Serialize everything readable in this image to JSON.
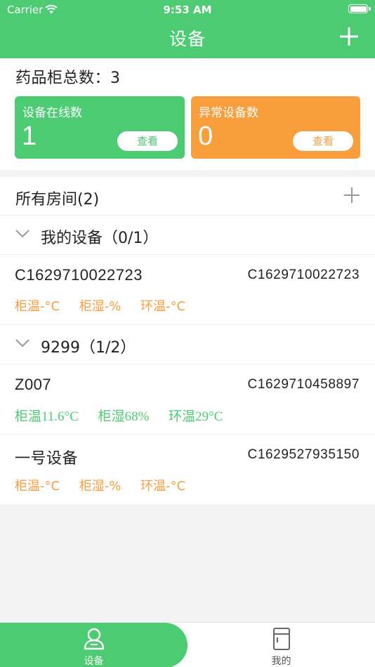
{
  "status_bar": {
    "carrier": "Carrier",
    "time": "9:53 AM"
  },
  "nav": {
    "title": "设备",
    "add_icon": "plus-icon"
  },
  "summary": {
    "total_label": "药品柜总数：3",
    "online": {
      "label": "设备在线数",
      "value": "1",
      "button": "查看",
      "color": "#4ccb72"
    },
    "abnormal": {
      "label": "异常设备数",
      "value": "0",
      "button": "查看",
      "color": "#f89e3c"
    }
  },
  "rooms": {
    "title": "所有房间(2)",
    "groups": [
      {
        "label": "我的设备（0/1）",
        "devices": [
          {
            "name": "C1629710022723",
            "id": "C1629710022723",
            "metrics": [
              "柜温-°C",
              "柜湿-%",
              "环温-°C"
            ],
            "status": "offline"
          }
        ]
      },
      {
        "label": "9299（1/2）",
        "devices": [
          {
            "name": "Z007",
            "id": "C1629710458897",
            "metrics": [
              "柜温11.6°C",
              "柜湿68%",
              "环温29°C"
            ],
            "status": "online"
          },
          {
            "name": "一号设备",
            "id": "C1629527935150",
            "metrics": [
              "柜温-°C",
              "柜湿-%",
              "环温-°C"
            ],
            "status": "offline"
          }
        ]
      }
    ]
  },
  "tabbar": {
    "tabs": [
      {
        "label": "设备",
        "icon": "person-icon",
        "active": true
      },
      {
        "label": "我的",
        "icon": "cabinet-icon",
        "active": false
      }
    ]
  },
  "colors": {
    "primary": "#4ccb72",
    "warning": "#f89e3c",
    "background": "#f3f3f3"
  }
}
